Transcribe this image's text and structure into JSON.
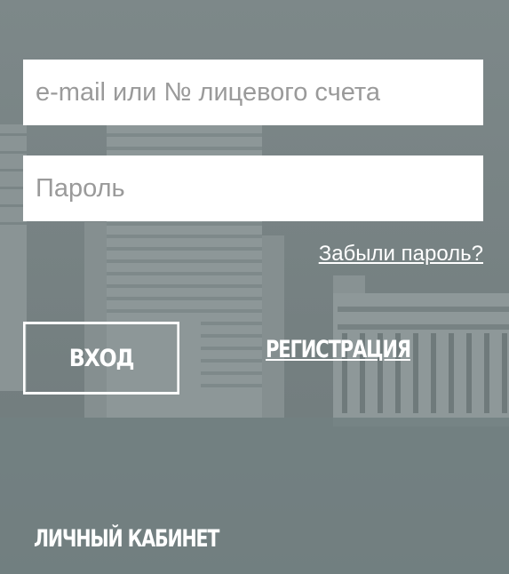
{
  "colors": {
    "background": "#7c8788",
    "field_background": "#ffffff",
    "text": "#ffffff",
    "placeholder": "#9a9a9a"
  },
  "login_form": {
    "login_placeholder": "e-mail или № лицевого счета",
    "login_value": "",
    "password_placeholder": "Пароль",
    "password_value": "",
    "forgot_password": "Забыли пароль?",
    "login_button": "ВХОД",
    "register_link": "РЕГИСТРАЦИЯ"
  },
  "footer": {
    "title": "ЛИЧНЫЙ КАБИНЕТ"
  }
}
